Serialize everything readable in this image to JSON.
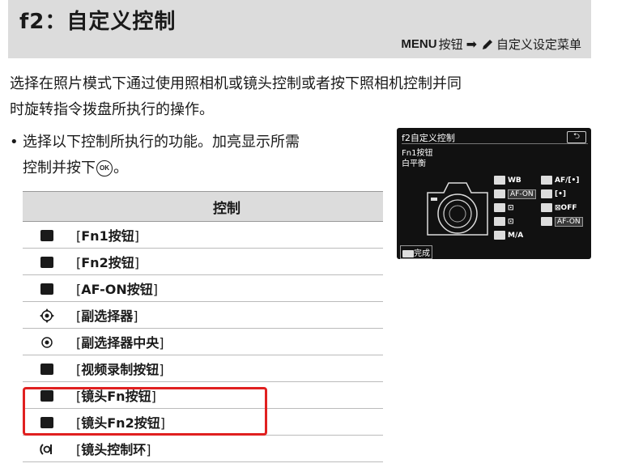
{
  "header": {
    "title": "f2：自定义控制",
    "menu_word": "MENU",
    "menu_button": "按钮",
    "menu_target": "自定义设定菜单"
  },
  "intro": {
    "line1": "选择在照片模式下通过使用照相机或镜头控制或者按下照相机控制并同",
    "line2": "时旋转指令拨盘所执行的操作。"
  },
  "bullet": {
    "line1": "选择以下控制所执行的功能。加亮显示所需",
    "line2_before": "控制并按下",
    "ok_label": "OK",
    "line2_after": "。"
  },
  "camera_screen": {
    "header": "f2自定义控制",
    "selected_control": "Fn1按钮",
    "selected_value": "白平衡",
    "return_symbol": "⮌",
    "done_label": "完成",
    "grid": [
      [
        {
          "icon": "fn1-icon",
          "value": "WB"
        },
        {
          "icon": "fn2-icon",
          "value": "AF/[•]"
        }
      ],
      [
        {
          "icon": "af-on-icon",
          "value": "AF-ON"
        },
        {
          "icon": "sub-selector-icon",
          "value": "[•]"
        }
      ],
      [
        {
          "icon": "sub-selector-center-icon",
          "value": "⊡"
        },
        {
          "icon": "movie-record-icon",
          "value": "⊠OFF"
        }
      ],
      [
        {
          "icon": "lens-fn-icon",
          "value": "⊡"
        },
        {
          "icon": "lens-fn2-icon",
          "value": "AF-ON"
        }
      ],
      [
        {
          "icon": "control-ring-icon",
          "value": "M/A"
        },
        null
      ]
    ]
  },
  "table": {
    "header": "控制",
    "rows": [
      {
        "icon": "fn1-button-icon",
        "label": "Fn1按钮"
      },
      {
        "icon": "fn2-button-icon",
        "label": "Fn2按钮"
      },
      {
        "icon": "af-on-button-icon",
        "label": "AF-ON按钮"
      },
      {
        "icon": "sub-selector-icon",
        "label": "副选择器"
      },
      {
        "icon": "sub-selector-center-icon",
        "label": "副选择器中央"
      },
      {
        "icon": "movie-record-button-icon",
        "label": "视频录制按钮"
      },
      {
        "icon": "lens-fn-button-icon",
        "label": "镜头Fn按钮"
      },
      {
        "icon": "lens-fn2-button-icon",
        "label": "镜头Fn2按钮"
      },
      {
        "icon": "lens-control-ring-icon",
        "label": "镜头控制环"
      }
    ],
    "highlighted_rows": [
      "镜头Fn按钮",
      "镜头Fn2按钮"
    ],
    "highlight_color": "#e02020"
  }
}
